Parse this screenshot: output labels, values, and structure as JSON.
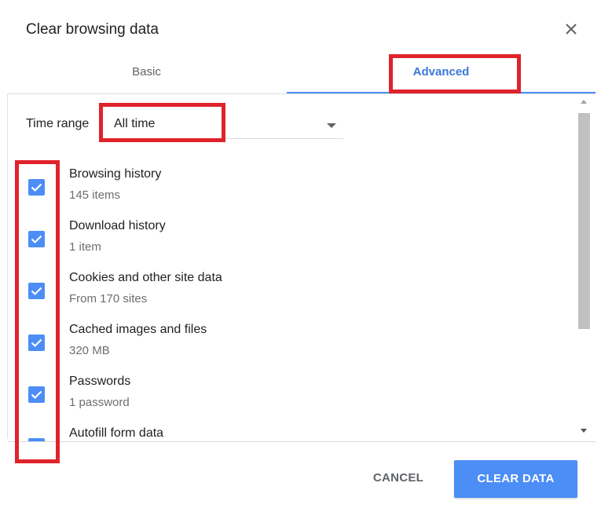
{
  "dialog": {
    "title": "Clear browsing data"
  },
  "tabs": [
    {
      "label": "Basic",
      "selected": false
    },
    {
      "label": "Advanced",
      "selected": true
    }
  ],
  "time_range": {
    "label": "Time range",
    "value": "All time"
  },
  "items": [
    {
      "title": "Browsing history",
      "subtitle": "145 items",
      "checked": true
    },
    {
      "title": "Download history",
      "subtitle": "1 item",
      "checked": true
    },
    {
      "title": "Cookies and other site data",
      "subtitle": "From 170 sites",
      "checked": true
    },
    {
      "title": "Cached images and files",
      "subtitle": "320 MB",
      "checked": true
    },
    {
      "title": "Passwords",
      "subtitle": "1 password",
      "checked": true
    },
    {
      "title": "Autofill form data",
      "subtitle": "",
      "checked": true
    }
  ],
  "buttons": {
    "cancel": "CANCEL",
    "clear": "CLEAR DATA"
  },
  "colors": {
    "accent": "#4c8df6",
    "tab_active_text": "#3c78d8",
    "highlight": "#e0232b"
  },
  "icons": {
    "close": "close-icon",
    "dropdown": "chevron-down-icon",
    "checkbox": "check-icon"
  }
}
